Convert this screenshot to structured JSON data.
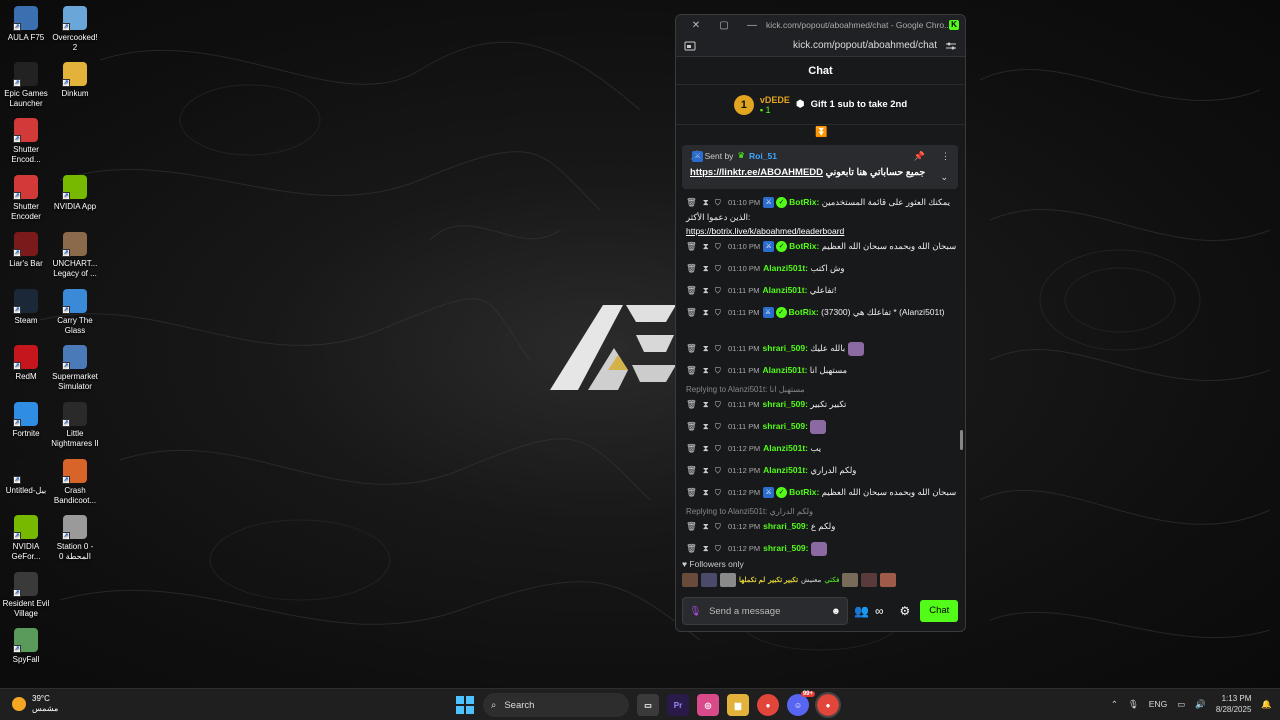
{
  "desktop": {
    "icons": [
      {
        "label": "AULA F75",
        "icon": "aula-app-icon",
        "color": "#3a6fb0"
      },
      {
        "label": "Overcooked! 2",
        "icon": "overcooked-app-icon",
        "color": "#6aa7d8"
      },
      {
        "label": "Epic Games Launcher",
        "icon": "epic-games-icon",
        "color": "#222222"
      },
      {
        "label": "Dinkum",
        "icon": "dinkum-app-icon",
        "color": "#e2b23a"
      },
      {
        "label": "Shutter Encod...",
        "icon": "shutter-encoder-icon",
        "color": "#d23a3a"
      },
      {
        "label": "Shutter Encoder",
        "icon": "shutter-encoder-icon",
        "color": "#d23a3a"
      },
      {
        "label": "NVIDIA App",
        "icon": "nvidia-app-icon",
        "color": "#76b900"
      },
      {
        "label": "Liar's Bar",
        "icon": "liars-bar-icon",
        "color": "#7a1a1a"
      },
      {
        "label": "UNCHART... Legacy of ...",
        "icon": "uncharted-app-icon",
        "color": "#8a6a4a"
      },
      {
        "label": "Steam",
        "icon": "steam-icon",
        "color": "#1b2838"
      },
      {
        "label": "Carry The Glass",
        "icon": "carry-the-glass-icon",
        "color": "#3b8ad8"
      },
      {
        "label": "RedM",
        "icon": "redm-icon",
        "color": "#c4161c"
      },
      {
        "label": "Supermarket Simulator",
        "icon": "supermarket-simulator-icon",
        "color": "#4a7ab8"
      },
      {
        "label": "Fortnite",
        "icon": "fortnite-icon",
        "color": "#2f8de4"
      },
      {
        "label": "Little Nightmares II",
        "icon": "little-nightmares-icon",
        "color": "#2a2a2a"
      },
      {
        "label": "Untitled-بيل",
        "icon": "file-icon",
        "color": "#111111"
      },
      {
        "label": "Crash Bandicoot...",
        "icon": "crash-bandicoot-icon",
        "color": "#d8642a"
      },
      {
        "label": "NVIDIA GeFor...",
        "icon": "nvidia-geforce-icon",
        "color": "#76b900"
      },
      {
        "label": "Station 0 - المحطة 0",
        "icon": "station-zero-icon",
        "color": "#9a9a9a"
      },
      {
        "label": "Resident Evil Village",
        "icon": "resident-evil-icon",
        "color": "#3a3a3a"
      },
      {
        "label": "SpyFall",
        "icon": "spyfall-icon",
        "color": "#5a9a5a"
      }
    ]
  },
  "window": {
    "title": "kick.com/popout/aboahmed/chat - Google Chro...",
    "url": "kick.com/popout/aboahmed/chat",
    "close_glyph": "✕",
    "restore_glyph": "▢",
    "minimize_glyph": "—",
    "favicon_letter": "K"
  },
  "chat": {
    "header": "Chat",
    "gift": {
      "rank": "1",
      "user": "vDEDE",
      "count": "1",
      "text": "Gift 1 sub to take 2nd"
    },
    "pinned": {
      "sent_by": "Sent by",
      "user": "Roi_51",
      "message": "جميع حساباتي هنا تابعوني",
      "link": "https://linktr.ee/ABOAHMEDD"
    },
    "messages": [
      {
        "time": "01:10 PM",
        "user": "BotRix:",
        "bot": true,
        "body": "يمكنك العثور على قائمة المستخدمين الذين دعموا الأكثر:",
        "link": "https://botrix.live/k/aboahmed/leaderboard"
      },
      {
        "time": "01:10 PM",
        "user": "BotRix:",
        "bot": true,
        "body": "سبحان الله وبحمده سبحان الله العظيم"
      },
      {
        "time": "01:10 PM",
        "user": "Alanzi501t:",
        "bot": false,
        "body": "وش اكتب"
      },
      {
        "time": "01:11 PM",
        "user": "Alanzi501t:",
        "bot": false,
        "body": "تفاعلي!"
      },
      {
        "time": "01:11 PM",
        "user": "BotRix:",
        "bot": true,
        "body": "(37300) تفاعلك هي * (Alanzi501t)"
      },
      {
        "time": "01:11 PM",
        "user": "shrari_509:",
        "bot": false,
        "body": "بالله عليك",
        "emote": true
      },
      {
        "time": "01:11 PM",
        "user": "Alanzi501t:",
        "bot": false,
        "body": "مستهبل انا"
      },
      {
        "time": "01:11 PM",
        "user": "shrari_509:",
        "bot": false,
        "body": "تكبير تكبير",
        "reply": "Replying to Alanzi501t: مستهبل انا"
      },
      {
        "time": "01:11 PM",
        "user": "shrari_509:",
        "bot": false,
        "body": "",
        "emote": true
      },
      {
        "time": "01:12 PM",
        "user": "Alanzi501t:",
        "bot": false,
        "body": "يب"
      },
      {
        "time": "01:12 PM",
        "user": "Alanzi501t:",
        "bot": false,
        "body": "ولكم الدراري"
      },
      {
        "time": "01:12 PM",
        "user": "BotRix:",
        "bot": true,
        "body": "سبحان الله وبحمده سبحان الله العظيم"
      },
      {
        "time": "01:12 PM",
        "user": "shrari_509:",
        "bot": false,
        "body": "ولكم ع",
        "reply": "Replying to Alanzi501t: ولكم الدراري"
      },
      {
        "time": "01:12 PM",
        "user": "shrari_509:",
        "bot": false,
        "body": "",
        "emote": true
      }
    ],
    "followers_only": "Followers only",
    "emote_strip_text": [
      "فكتي",
      "معنيش",
      "تكبير تكبير",
      "لم تكملها"
    ],
    "input_placeholder": "Send a message",
    "chat_button": "Chat"
  },
  "taskbar": {
    "temperature": "39°C",
    "condition": "مشمس",
    "search_label": "Search",
    "language": "ENG",
    "time": "1:13 PM",
    "date": "8/28/2025",
    "notif_badge": "99+"
  }
}
